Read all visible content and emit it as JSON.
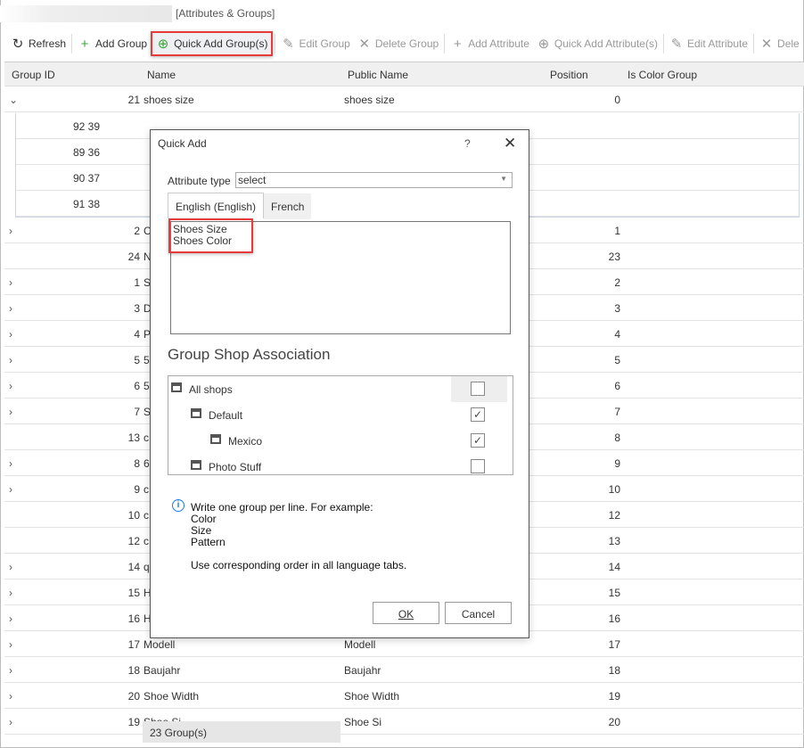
{
  "window": {
    "title": "[Attributes & Groups]"
  },
  "toolbar": [
    {
      "label": "Refresh",
      "icon": "refresh-icon",
      "glyph": "↻",
      "enabled": true
    },
    {
      "label": "Add Group",
      "icon": "plus-icon",
      "glyph": "+",
      "enabled": true
    },
    {
      "label": "Quick Add Group(s)",
      "icon": "plus-circle-icon",
      "glyph": "⊕",
      "enabled": true,
      "highlighted": true
    },
    {
      "label": "Edit Group",
      "icon": "pencil-icon",
      "glyph": "✎",
      "enabled": false
    },
    {
      "label": "Delete Group",
      "icon": "x-icon",
      "glyph": "✕",
      "enabled": false
    },
    {
      "label": "Add Attribute",
      "icon": "plus-icon",
      "glyph": "+",
      "enabled": false
    },
    {
      "label": "Quick Add Attribute(s)",
      "icon": "plus-circle-icon",
      "glyph": "⊕",
      "enabled": false
    },
    {
      "label": "Edit Attribute",
      "icon": "pencil-icon",
      "glyph": "✎",
      "enabled": false
    },
    {
      "label": "Dele",
      "icon": "x-icon",
      "glyph": "✕",
      "enabled": false
    }
  ],
  "grid": {
    "columns": [
      "Group ID",
      "Name",
      "Public Name",
      "Position",
      "Is Color Group"
    ],
    "expanded_row": {
      "id": "21",
      "name": "shoes size",
      "public_name": "shoes size",
      "position": "0"
    },
    "sub_rows": [
      "92 39",
      "89 36",
      "90 37",
      "91 38"
    ],
    "rows": [
      {
        "id": "2",
        "name": "C",
        "public": "",
        "pos": "1",
        "exp": true
      },
      {
        "id": "24",
        "name": "N",
        "public": "",
        "pos": "23",
        "exp": false
      },
      {
        "id": "1",
        "name": "S",
        "public": "",
        "pos": "2",
        "exp": true
      },
      {
        "id": "3",
        "name": "D",
        "public": "",
        "pos": "3",
        "exp": true
      },
      {
        "id": "4",
        "name": "P",
        "public": "",
        "pos": "4",
        "exp": true
      },
      {
        "id": "5",
        "name": "5",
        "public": "",
        "pos": "5",
        "exp": true
      },
      {
        "id": "6",
        "name": "5",
        "public": "",
        "pos": "6",
        "exp": true
      },
      {
        "id": "7",
        "name": "S",
        "public": "",
        "pos": "7",
        "exp": true
      },
      {
        "id": "13",
        "name": "c",
        "public": "",
        "pos": "8",
        "exp": false
      },
      {
        "id": "8",
        "name": "6",
        "public": "",
        "pos": "9",
        "exp": true
      },
      {
        "id": "9",
        "name": "c",
        "public": "",
        "pos": "10",
        "exp": true
      },
      {
        "id": "10",
        "name": "c",
        "public": "",
        "pos": "12",
        "exp": false
      },
      {
        "id": "12",
        "name": "c",
        "public": "",
        "pos": "13",
        "exp": false
      },
      {
        "id": "14",
        "name": "q",
        "public": "",
        "pos": "14",
        "exp": true
      },
      {
        "id": "15",
        "name": "H",
        "public": "",
        "pos": "15",
        "exp": true
      },
      {
        "id": "16",
        "name": "H",
        "public": "",
        "pos": "16",
        "exp": true
      },
      {
        "id": "17",
        "name": "Modell",
        "public": "Modell",
        "pos": "17",
        "exp": true
      },
      {
        "id": "18",
        "name": "Baujahr",
        "public": "Baujahr",
        "pos": "18",
        "exp": true
      },
      {
        "id": "20",
        "name": "Shoe Width",
        "public": "Shoe Width",
        "pos": "19",
        "exp": true
      },
      {
        "id": "19",
        "name": "Shoe Si",
        "public": "Shoe Si",
        "pos": "20",
        "exp": true
      }
    ],
    "footer": "23 Group(s)"
  },
  "dialog": {
    "title": "Quick Add",
    "help": "?",
    "close": "✕",
    "attribute_type_label": "Attribute type",
    "attribute_type_value": "select",
    "tabs": [
      "English (English)",
      "French"
    ],
    "text_lines": [
      "Shoes Size",
      "Shoes Color"
    ],
    "section_title": "Group Shop Association",
    "shops": [
      {
        "label": "All shops",
        "checked": false,
        "level": 0
      },
      {
        "label": "Default",
        "checked": true,
        "level": 1
      },
      {
        "label": "Mexico",
        "checked": true,
        "level": 2
      },
      {
        "label": "Photo Stuff",
        "checked": false,
        "level": 1
      }
    ],
    "info_lines": [
      "Write one group per line. For example:",
      "Color",
      "Size",
      "Pattern"
    ],
    "info_note": "Use corresponding order in all language tabs.",
    "ok": "OK",
    "cancel": "Cancel"
  },
  "colors": {
    "highlight": "#e8393b",
    "info": "#1e7be0",
    "add_icon": "#3aa53a"
  }
}
